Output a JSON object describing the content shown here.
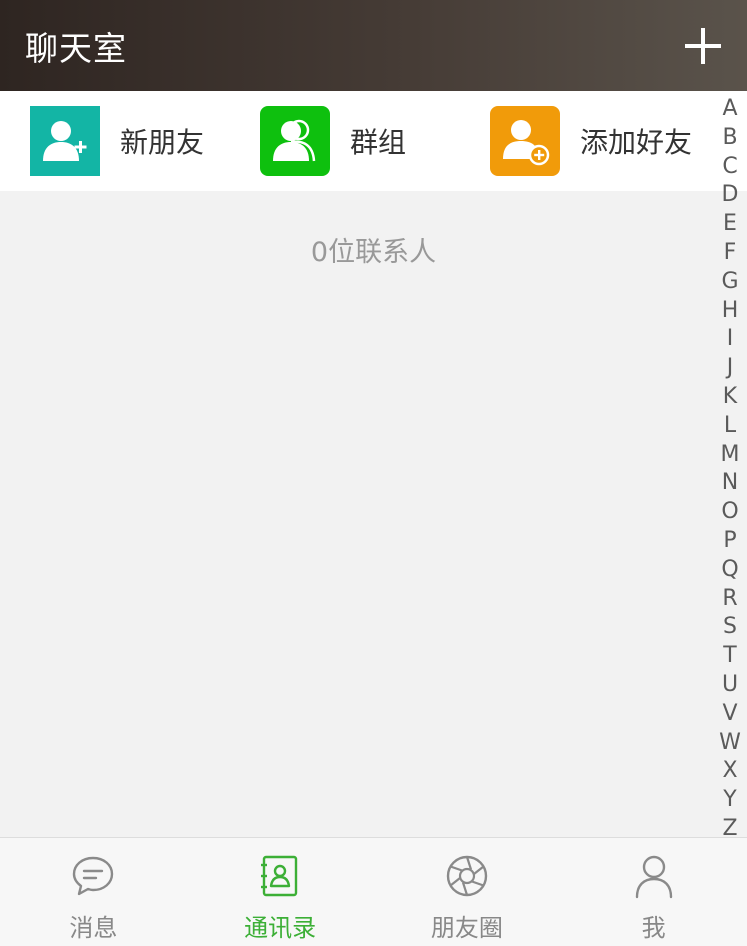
{
  "header": {
    "title": "聊天室",
    "add_icon": "plus-icon"
  },
  "quick_entries": [
    {
      "label": "新朋友",
      "icon": "new-friend-icon",
      "color": "#13b5a5"
    },
    {
      "label": "群组",
      "icon": "group-icon",
      "color": "#0ec00e"
    },
    {
      "label": "添加好友",
      "icon": "add-friend-icon",
      "color": "#f19b0a"
    }
  ],
  "contacts": {
    "count_text": "0位联系人"
  },
  "index_letters": [
    "A",
    "B",
    "C",
    "D",
    "E",
    "F",
    "G",
    "H",
    "I",
    "J",
    "K",
    "L",
    "M",
    "N",
    "O",
    "P",
    "Q",
    "R",
    "S",
    "T",
    "U",
    "V",
    "W",
    "X",
    "Y",
    "Z"
  ],
  "tabbar": {
    "active": "contacts",
    "active_color": "#3caf36",
    "tabs": [
      {
        "key": "messages",
        "label": "消息",
        "icon": "chat-bubble-icon"
      },
      {
        "key": "contacts",
        "label": "通讯录",
        "icon": "address-book-icon"
      },
      {
        "key": "moments",
        "label": "朋友圈",
        "icon": "aperture-icon"
      },
      {
        "key": "me",
        "label": "我",
        "icon": "user-icon"
      }
    ]
  }
}
